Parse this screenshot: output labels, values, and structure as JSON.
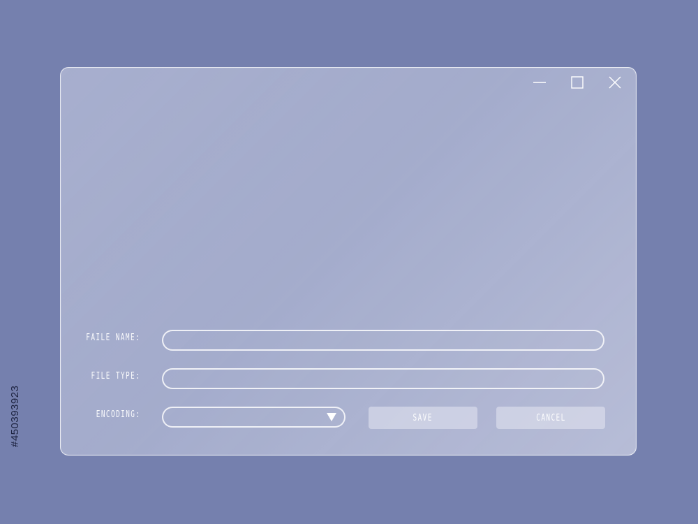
{
  "stock": {
    "id": "#450393923"
  },
  "window": {
    "controls": {
      "minimize_icon": "minimize-icon",
      "maximize_icon": "maximize-icon",
      "close_icon": "close-icon"
    },
    "form": {
      "file_name": {
        "label": "FAILE NAME:",
        "value": "",
        "placeholder": ""
      },
      "file_type": {
        "label": "FILE TYPE:",
        "value": "",
        "placeholder": ""
      },
      "encoding": {
        "label": "ENCODING:",
        "selected": ""
      },
      "actions": {
        "save_label": "SAVE",
        "cancel_label": "CANCEL"
      }
    }
  },
  "colors": {
    "background": "#7580ae",
    "panel": "#c7cbe1",
    "panel_border": "#eef0f8",
    "button": "#d0d4e7",
    "text": "#ffffff"
  }
}
